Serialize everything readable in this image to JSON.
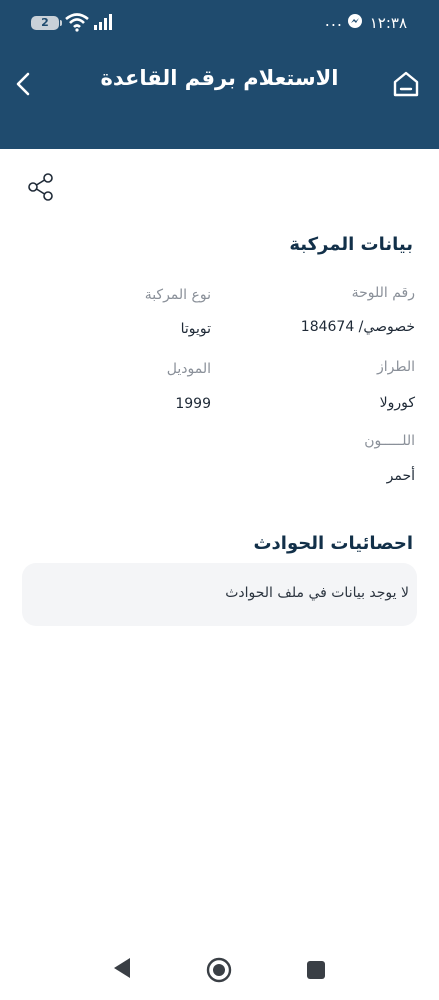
{
  "status_bar": {
    "time": "١٢:٣٨",
    "dots": "...",
    "battery_level": "2",
    "icons": [
      "messenger-icon",
      "wifi-icon",
      "signal-icon",
      "battery-icon"
    ]
  },
  "header": {
    "title": "الاستعلام برقم القاعدة",
    "background": "#1f4b6e"
  },
  "vehicle": {
    "section_title": "بيانات المركبة",
    "plate_label": "رقم اللوحة",
    "plate_value": "خصوصي/ 184674",
    "type_label": "نوع المركبة",
    "type_value": "تويوتا",
    "style_label": "الطراز",
    "style_value": "كورولا",
    "model_label": "الموديل",
    "model_value": "1999",
    "color_label": "اللـــــون",
    "color_value": "أحمر"
  },
  "accidents": {
    "section_title": "احصائيات الحوادث",
    "empty_message": "لا يوجد بيانات  في ملف الحوادث"
  },
  "nav_icons": [
    "back-triangle-icon",
    "home-circle-icon",
    "recents-square-icon"
  ]
}
